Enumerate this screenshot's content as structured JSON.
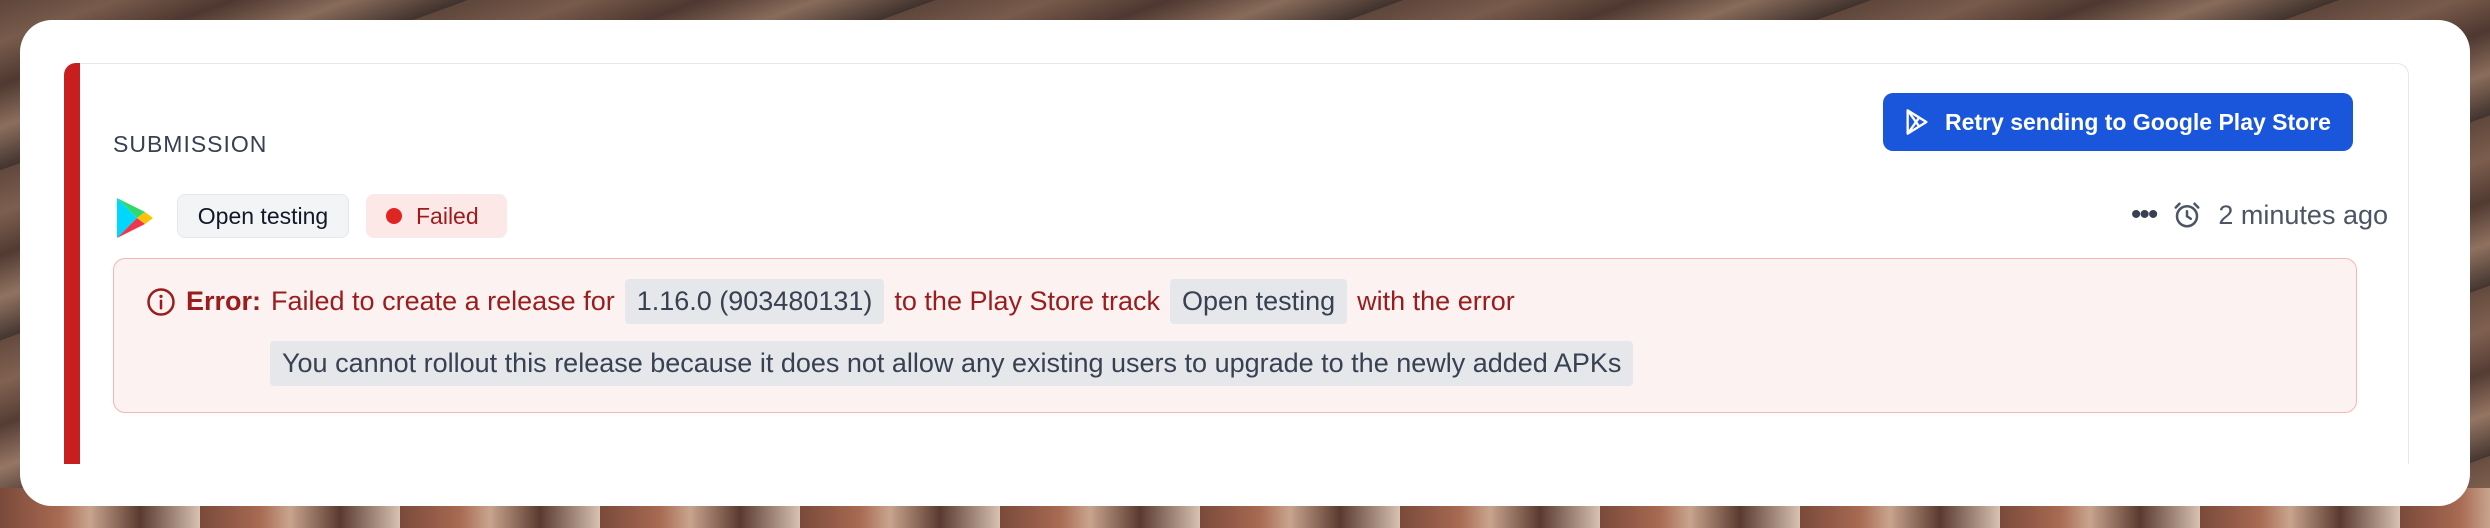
{
  "section": {
    "title": "SUBMISSION"
  },
  "retry_button": {
    "label": "Retry sending to Google Play Store"
  },
  "submission": {
    "track_tag": "Open testing",
    "status_tag": "Failed",
    "time_ago": "2 minutes ago"
  },
  "error": {
    "prefix": "Error:",
    "text1": "Failed to create a release for",
    "version": "1.16.0 (903480131)",
    "text2": "to the Play Store track",
    "track": "Open testing",
    "text3": "with the error",
    "message": "You cannot rollout this release because it does not allow any existing users to upgrade to the newly added APKs"
  },
  "colors": {
    "accent": "#c81e1e",
    "primary_button": "#1a56db",
    "error_bg": "#fdf2f2",
    "error_text": "#9b1c1c"
  },
  "icons": {
    "play": "google-play-icon",
    "more": "more-horizontal-icon",
    "clock": "alarm-clock-icon",
    "info": "info-circle-icon"
  }
}
